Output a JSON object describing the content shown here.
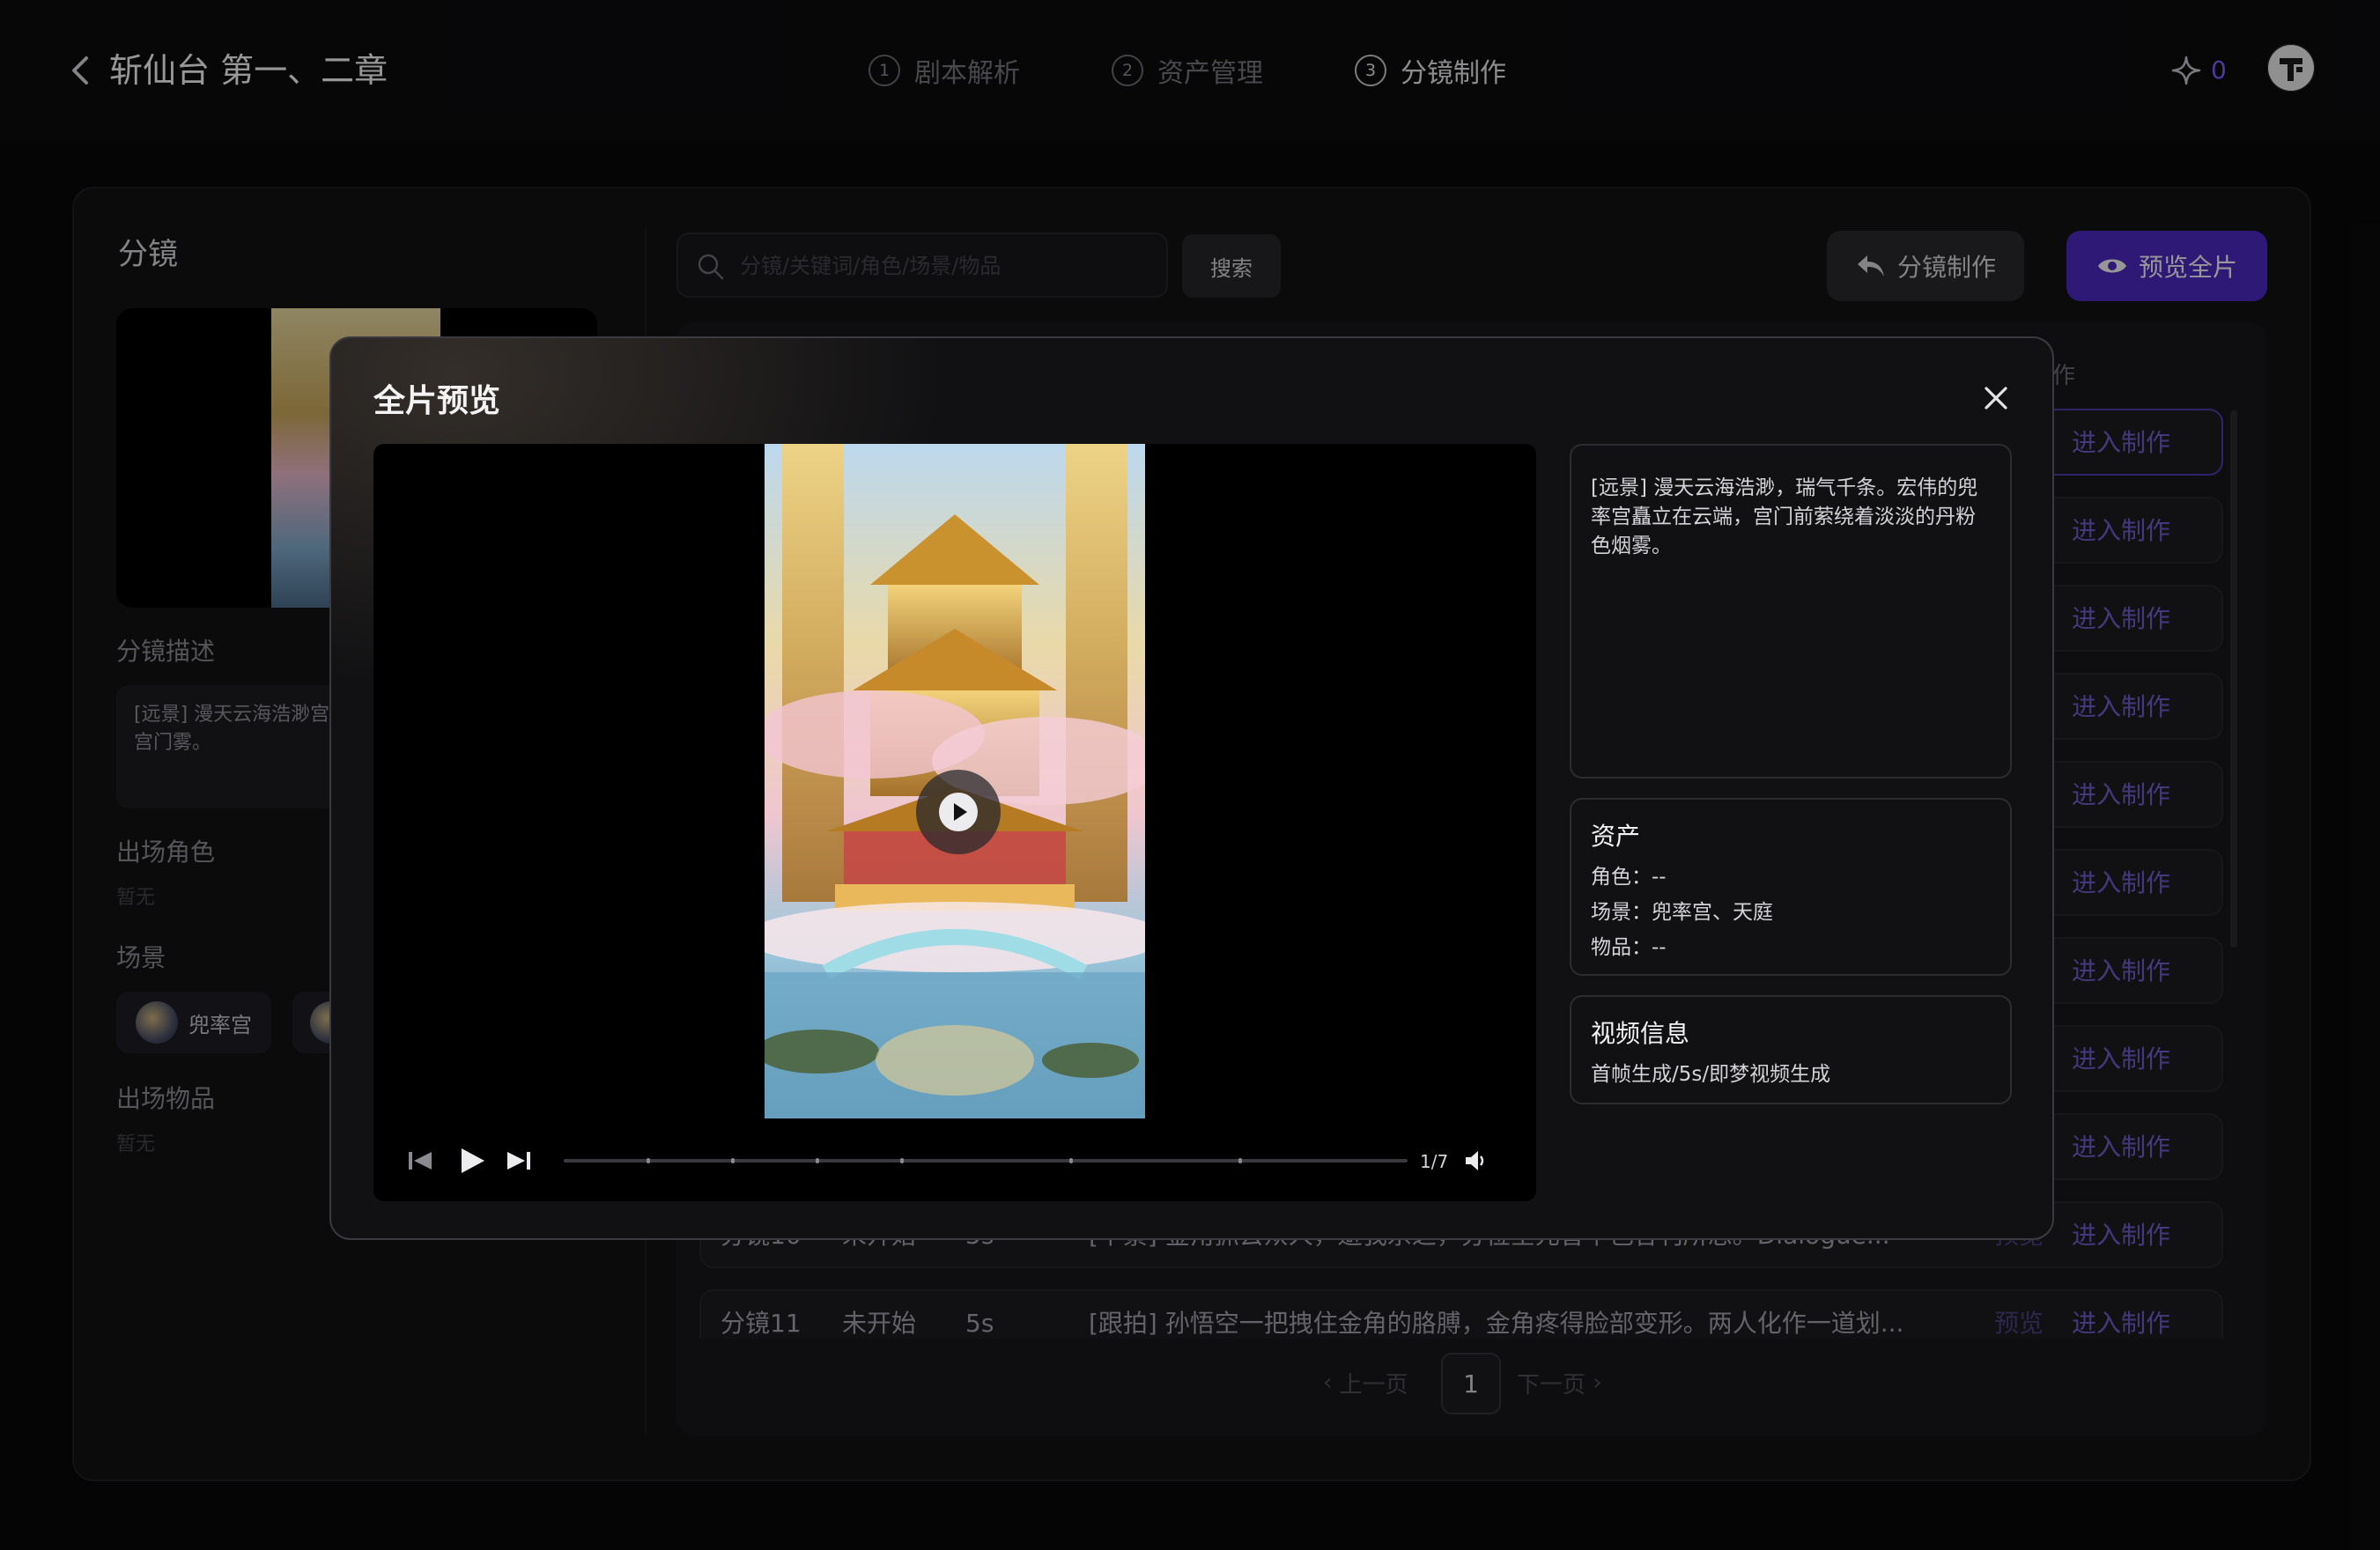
{
  "header": {
    "project_title": "斩仙台 第一、二章",
    "steps": [
      {
        "num": "1",
        "label": "剧本解析"
      },
      {
        "num": "2",
        "label": "资产管理"
      },
      {
        "num": "3",
        "label": "分镜制作"
      }
    ],
    "credits": "0"
  },
  "left_panel": {
    "title": "分镜",
    "desc_label": "分镜描述",
    "desc_text": "[远景] 漫天云海浩渺，瑞气千条。宏伟的兜率宫矗立在云端，宫门前萦绕着淡淡的丹粉色烟雾。",
    "desc_text_visible": "[远景] 漫天云海浩渺宫矗立在云端，宫门雾。",
    "characters_label": "出场角色",
    "characters_empty": "暂无",
    "scene_label": "场景",
    "scenes": [
      "兜率宫"
    ],
    "items_label": "出场物品",
    "items_empty": "暂无"
  },
  "toolbar": {
    "search_placeholder": "分镜/关键词/角色/场景/物品",
    "search_button": "搜索",
    "make_button": "分镜制作",
    "preview_button": "预览全片"
  },
  "list": {
    "column_partial": "作",
    "enter_label": "进入制作",
    "preview_label": "预览",
    "row10": {
      "name": "分镜10",
      "status": "未开始",
      "duration": "5s",
      "desc": "[中景] 金角抓去众人，避我杀之，分位空元智中色各刊所思。Dialogue..."
    },
    "row11": {
      "name": "分镜11",
      "status": "未开始",
      "duration": "5s",
      "desc": "[跟拍] 孙悟空一把拽住金角的胳膊，金角疼得脸部变形。两人化作一道划..."
    }
  },
  "pagination": {
    "prev": "上一页",
    "current": "1",
    "next": "下一页"
  },
  "modal": {
    "title": "全片预览",
    "counter": "1/7",
    "description": "[远景] 漫天云海浩渺，瑞气千条。宏伟的兜率宫矗立在云端，宫门前萦绕着淡淡的丹粉色烟雾。",
    "assets_title": "资产",
    "assets_character": "角色：--",
    "assets_scene": "场景：兜率宫、天庭",
    "assets_item": "物品：--",
    "video_title": "视频信息",
    "video_info": "首帧生成/5s/即梦视频生成",
    "progress": 0
  },
  "icons": {
    "back": "chevron-left-icon",
    "sparkle": "sparkle-icon",
    "search": "search-icon",
    "reply": "reply-arrow-icon",
    "eye": "eye-icon",
    "close": "close-icon",
    "play": "play-icon",
    "prev": "skip-previous-icon",
    "next": "skip-next-icon",
    "volume": "volume-icon"
  },
  "colors": {
    "accent": "#4b2bbf",
    "accent_text": "#6f5cc8",
    "credit": "#7c5cff"
  }
}
